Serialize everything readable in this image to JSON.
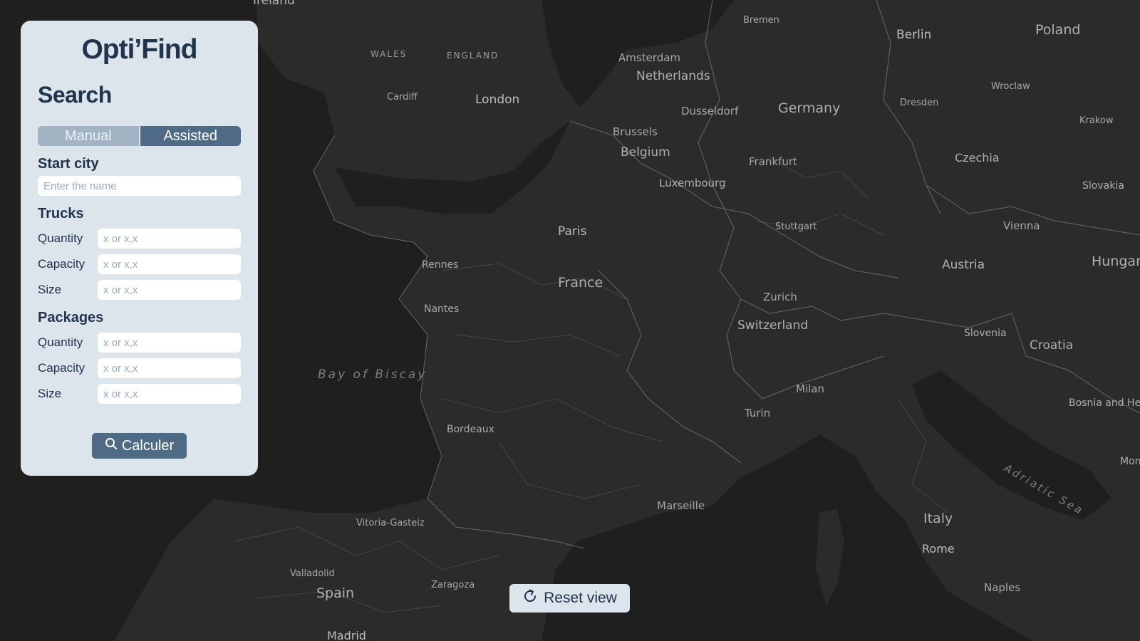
{
  "app": {
    "brand": "Opti’Find"
  },
  "search": {
    "title": "Search",
    "modes": {
      "manual": "Manual",
      "assisted": "Assisted",
      "active": "Assisted"
    },
    "start_city": {
      "label": "Start city",
      "placeholder": "Enter the name"
    },
    "trucks": {
      "title": "Trucks",
      "fields": [
        {
          "label": "Quantity",
          "placeholder": "x or x,x"
        },
        {
          "label": "Capacity",
          "placeholder": "x or x,x"
        },
        {
          "label": "Size",
          "placeholder": "x or x,x"
        }
      ]
    },
    "packages": {
      "title": "Packages",
      "fields": [
        {
          "label": "Quantity",
          "placeholder": "x or x,x"
        },
        {
          "label": "Capacity",
          "placeholder": "x or x,x"
        },
        {
          "label": "Size",
          "placeholder": "x or x,x"
        }
      ]
    },
    "submit_label": "Calculer",
    "submit_icon": "search-icon"
  },
  "map": {
    "reset_label": "Reset view",
    "reset_icon": "refresh-icon",
    "colors": {
      "land": "#2b2b2b",
      "sea": "#1f1f1f",
      "border": "#9a9a9a"
    },
    "countries": [
      "Ireland",
      "Netherlands",
      "Germany",
      "Poland",
      "Belgium",
      "Luxembourg",
      "Czechia",
      "Slovakia",
      "France",
      "Austria",
      "Hungary",
      "Switzerland",
      "Slovenia",
      "Croatia",
      "Bosnia and Herzegovina",
      "Italy",
      "Spain",
      "Montenegro"
    ],
    "regions": [
      "WALES",
      "ENGLAND"
    ],
    "cities": [
      "Bremen",
      "Berlin",
      "Amsterdam",
      "London",
      "Cardiff",
      "Dusseldorf",
      "Dresden",
      "Wroclaw",
      "Krakow",
      "Brussels",
      "Frankfurt",
      "Stuttgart",
      "Paris",
      "Vienna",
      "Rennes",
      "Zurich",
      "Nantes",
      "Milan",
      "Turin",
      "Bordeaux",
      "Marseille",
      "Vitoria-Gasteiz",
      "Rome",
      "Valladolid",
      "Zaragoza",
      "Naples",
      "Madrid"
    ],
    "seas": [
      "Bay of Biscay",
      "Adriatic Sea"
    ]
  }
}
